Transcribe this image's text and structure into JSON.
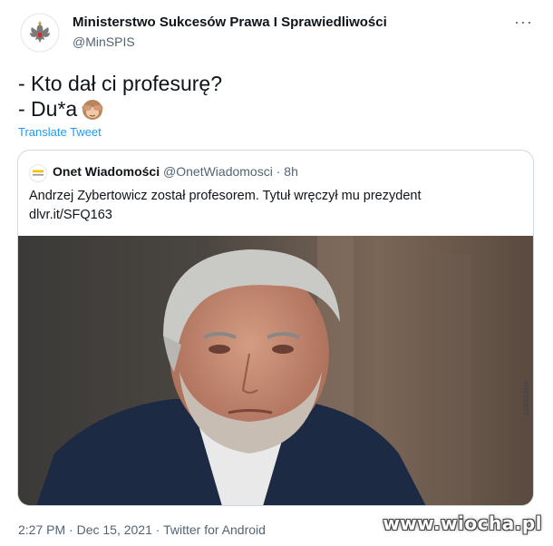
{
  "author": {
    "name": "Ministerstwo Sukcesów Prawa I Sprawiedliwości",
    "handle": "@MinSPIS",
    "avatar_icon": "eagle-emblem-icon"
  },
  "menu_icon_glyph": "···",
  "tweet": {
    "line1": "- Kto dał ci profesurę?",
    "line2": "- Du*a",
    "emoji_icon": "see-no-evil-monkey-icon",
    "translate_label": "Translate Tweet"
  },
  "quote": {
    "avatar_icon": "onet-logo-icon",
    "name": "Onet Wiadomości",
    "handle": "@OnetWiadomosci",
    "separator": " · ",
    "time": "8h",
    "text": "Andrzej Zybertowicz został profesorem. Tytuł wręczył mu prezydent",
    "link": "dlvr.it/SFQ163",
    "image_icon": "man-portrait-photo"
  },
  "footer": {
    "time": "2:27 PM",
    "separator": " · ",
    "date": "Dec 15, 2021",
    "source": "Twitter for Android"
  },
  "watermark": "www.wiocha.pl",
  "side_watermark": "zakazane",
  "colors": {
    "link": "#1d9bf0",
    "secondary_text": "#536471",
    "border": "#cfd9de"
  }
}
